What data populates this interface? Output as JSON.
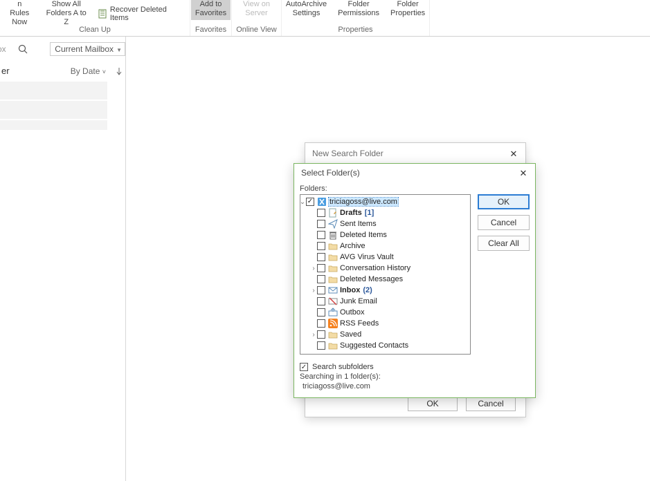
{
  "ribbon": {
    "cleanup": {
      "items": [
        {
          "l1": "n Rules",
          "l2": "Now"
        },
        {
          "l1": "Show All",
          "l2": "Folders A to Z"
        }
      ],
      "recover": "Recover Deleted Items",
      "label": "Clean Up"
    },
    "favorites": {
      "btn_l1": "Add to",
      "btn_l2": "Favorites",
      "label": "Favorites"
    },
    "onlineview": {
      "btn_l1": "View on",
      "btn_l2": "Server",
      "label": "Online View"
    },
    "properties": {
      "archive_l1": "AutoArchive",
      "archive_l2": "Settings",
      "perm_l1": "Folder",
      "perm_l2": "Permissions",
      "props_l1": "Folder",
      "props_l2": "Properties",
      "label": "Properties"
    }
  },
  "leftpane": {
    "search_placeholder": "ox",
    "scope": "Current Mailbox",
    "header_left": "er",
    "sort": "By Date"
  },
  "parent_dialog": {
    "title": "New Search Folder",
    "ok": "OK",
    "cancel": "Cancel"
  },
  "select_dialog": {
    "title": "Select Folder(s)",
    "folders_label": "Folders:",
    "ok": "OK",
    "cancel": "Cancel",
    "clear_all": "Clear All",
    "search_subfolders": "Search subfolders",
    "status_line1": "Searching in 1 folder(s):",
    "status_line2": "triciagoss@live.com",
    "tree": {
      "root": {
        "label": "triciagoss@live.com",
        "checked": true,
        "icon": "account",
        "expander": "v",
        "indent": 1,
        "selected": true
      },
      "items": [
        {
          "label": "Drafts",
          "count": "[1]",
          "bold": true,
          "icon": "draft",
          "expander": "",
          "indent": 2
        },
        {
          "label": "Sent Items",
          "icon": "sent",
          "expander": "",
          "indent": 2
        },
        {
          "label": "Deleted Items",
          "icon": "trash",
          "expander": "",
          "indent": 2
        },
        {
          "label": "Archive",
          "icon": "folder",
          "expander": "",
          "indent": 2
        },
        {
          "label": "AVG Virus Vault",
          "icon": "folder",
          "expander": "",
          "indent": 2
        },
        {
          "label": "Conversation History",
          "icon": "folder",
          "expander": ">",
          "indent": 2
        },
        {
          "label": "Deleted Messages",
          "icon": "folder",
          "expander": "",
          "indent": 2
        },
        {
          "label": "Inbox",
          "count": "(2)",
          "bold": true,
          "icon": "mail",
          "expander": ">",
          "indent": 2
        },
        {
          "label": "Junk Email",
          "icon": "junk",
          "expander": "",
          "indent": 2
        },
        {
          "label": "Outbox",
          "icon": "outbox",
          "expander": "",
          "indent": 2
        },
        {
          "label": "RSS Feeds",
          "icon": "rss",
          "expander": "",
          "indent": 2
        },
        {
          "label": "Saved",
          "icon": "folder",
          "expander": ">",
          "indent": 2
        },
        {
          "label": "Suggested Contacts",
          "icon": "folder",
          "expander": "",
          "indent": 2
        }
      ]
    }
  }
}
